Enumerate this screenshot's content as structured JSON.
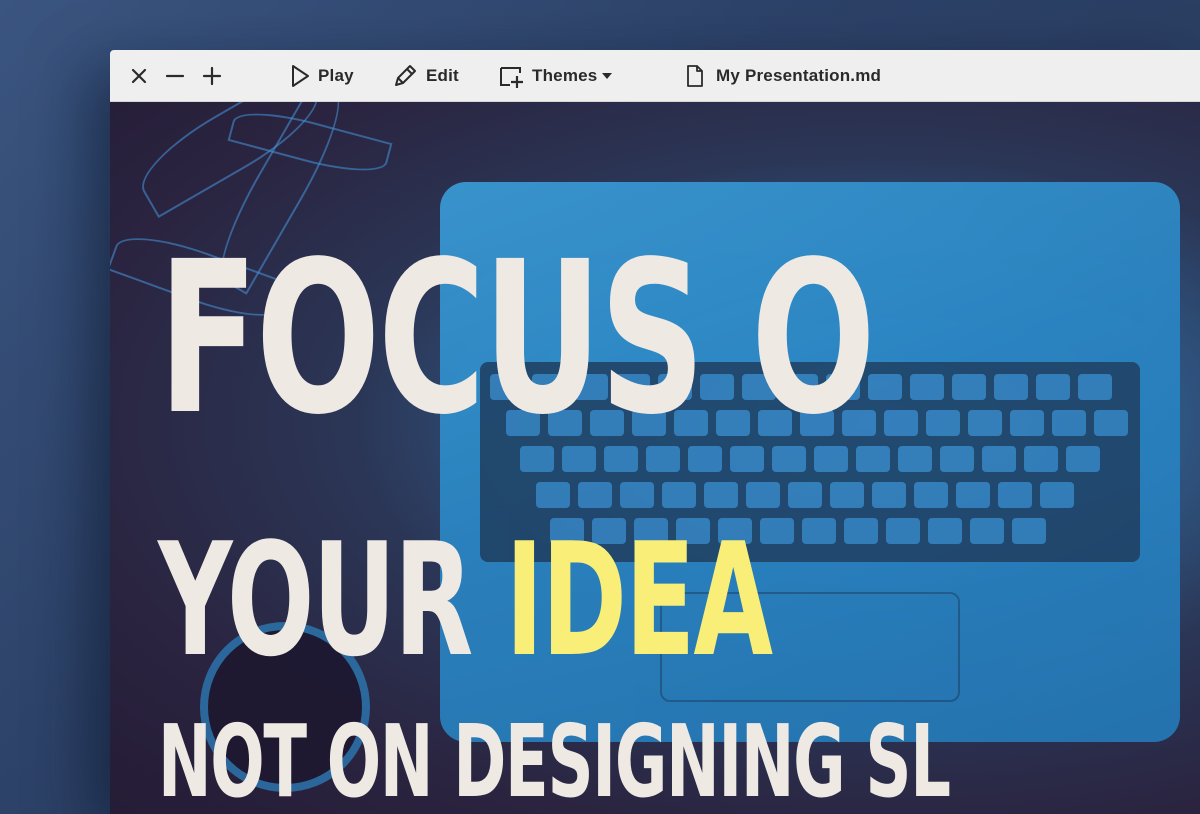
{
  "window_controls": {
    "close_icon": "close-icon",
    "minimize_icon": "minimize-icon",
    "maximize_icon": "plus-icon"
  },
  "toolbar": {
    "play_label": "Play",
    "edit_label": "Edit",
    "themes_label": "Themes",
    "file_name": "My Presentation.md"
  },
  "slide": {
    "line1": "FOCUS O",
    "line2_prefix": "YOUR ",
    "line2_highlight": "IDEA",
    "line3": "NOT ON DESIGNING SL"
  },
  "colors": {
    "headline": "#eee9e3",
    "highlight": "#f8ee78",
    "toolbar_bg": "#efefef"
  }
}
